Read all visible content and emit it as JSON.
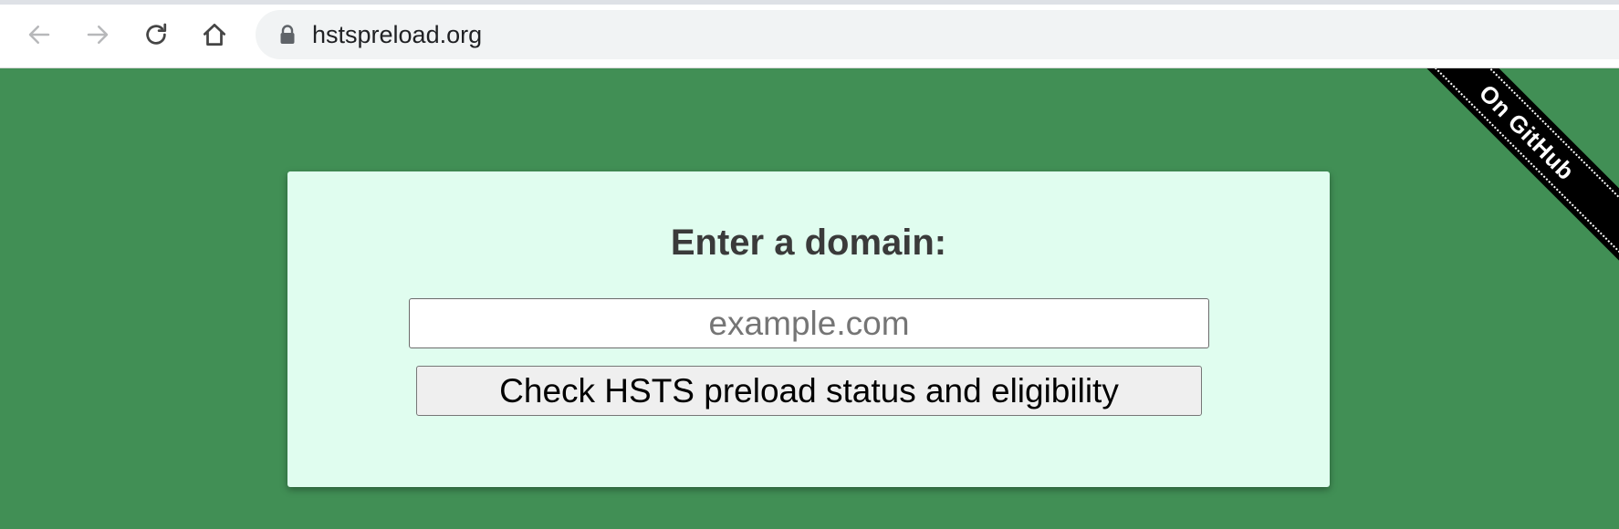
{
  "browser": {
    "url": "hstspreload.org",
    "back_icon": "arrow-left-icon",
    "forward_icon": "arrow-right-icon",
    "reload_icon": "reload-icon",
    "home_icon": "home-icon",
    "lock_icon": "lock-icon"
  },
  "colors": {
    "page_background": "#418f55",
    "card_background": "#e0fdef",
    "heading_text": "#3a3a3a",
    "ribbon_background": "#000000"
  },
  "form": {
    "heading": "Enter a domain:",
    "domain_placeholder": "example.com",
    "domain_value": "",
    "submit_label": "Check HSTS preload status and eligibility"
  },
  "ribbon": {
    "label": "On GitHub"
  }
}
